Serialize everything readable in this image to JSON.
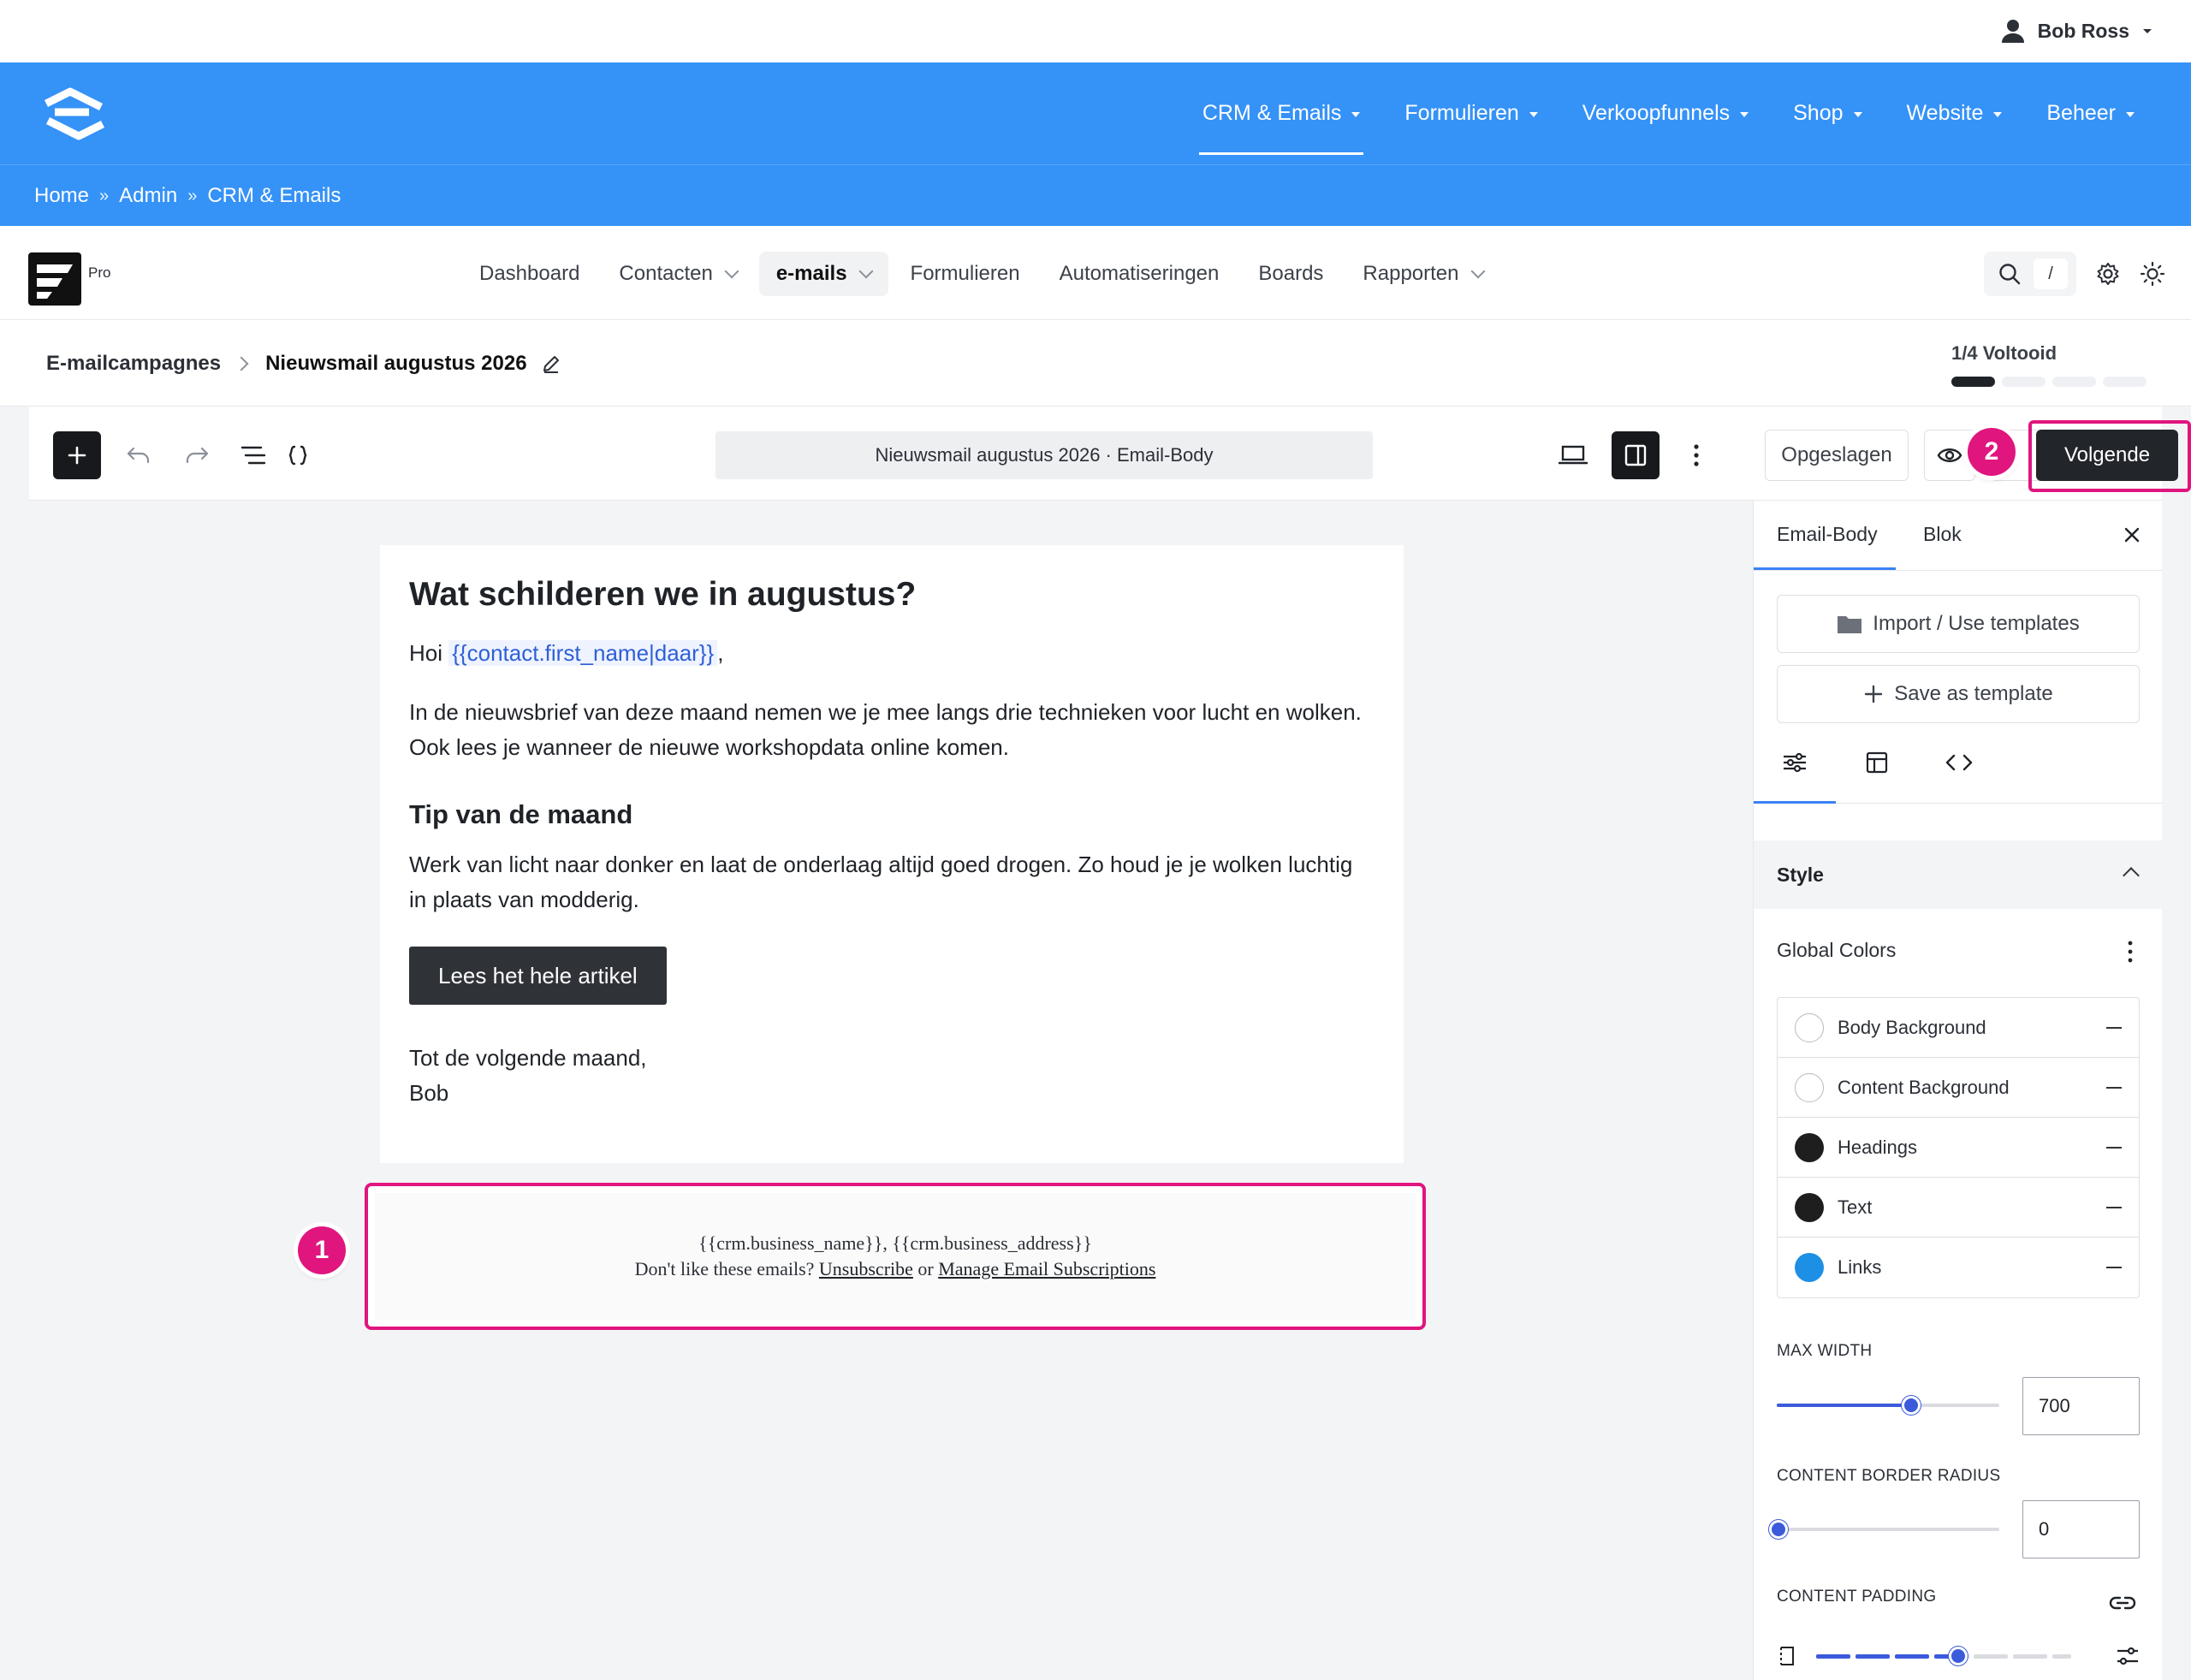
{
  "user": {
    "name": "Bob Ross"
  },
  "site_nav": {
    "items": [
      {
        "label": "CRM & Emails",
        "active": true
      },
      {
        "label": "Formulieren"
      },
      {
        "label": "Verkoopfunnels"
      },
      {
        "label": "Shop"
      },
      {
        "label": "Website"
      },
      {
        "label": "Beheer"
      }
    ]
  },
  "breadcrumb": {
    "items": [
      "Home",
      "Admin",
      "CRM & Emails"
    ],
    "separator": "»"
  },
  "app": {
    "badge": "Pro",
    "nav": [
      "Dashboard",
      "Contacten",
      "e-mails",
      "Formulieren",
      "Automatiseringen",
      "Boards",
      "Rapporten"
    ],
    "search_shortcut": "/"
  },
  "campaign": {
    "parent": "E-mailcampagnes",
    "name": "Nieuwsmail augustus 2026",
    "progress_label": "1/4 Voltooid",
    "progress": {
      "done": 1,
      "total": 4
    }
  },
  "editor": {
    "doc_title": "Nieuwsmail augustus 2026 · Email-Body",
    "saved_label": "Opgeslagen",
    "next_label": "Volgende",
    "markers": [
      "1",
      "2"
    ]
  },
  "email": {
    "heading": "Wat schilderen we in augustus?",
    "greeting_prefix": "Hoi",
    "greeting_tag": "{{contact.first_name|daar}}",
    "greeting_suffix": ",",
    "intro": "In de nieuwsbrief van deze maand nemen we je mee langs drie technieken voor lucht en wolken. Ook lees je wanneer de nieuwe workshopdata online komen.",
    "subheading": "Tip van de maand",
    "tip": "Werk van licht naar donker en laat de onderlaag altijd goed drogen. Zo houd je je wolken luchtig in plaats van modderig.",
    "button_label": "Lees het hele artikel",
    "closing": "Tot de volgende maand,",
    "signature": "Bob",
    "footer": {
      "business_line": "{{crm.business_name}}, {{crm.business_address}}",
      "unsub_prefix": "Don't like these emails?",
      "unsub_link": "Unsubscribe",
      "or": "or",
      "manage_link": "Manage Email Subscriptions"
    }
  },
  "panel": {
    "tabs": [
      "Email-Body",
      "Blok"
    ],
    "import_label": "Import / Use templates",
    "save_template_label": "Save as template",
    "section_title": "Style",
    "global_colors_label": "Global Colors",
    "colors": [
      {
        "name": "Body Background",
        "color": "#ffffff"
      },
      {
        "name": "Content Background",
        "color": "#ffffff"
      },
      {
        "name": "Headings",
        "color": "#1e1e1e"
      },
      {
        "name": "Text",
        "color": "#1e1e1e"
      },
      {
        "name": "Links",
        "color": "#1d8fe4"
      }
    ],
    "max_width_label": "MAX WIDTH",
    "max_width_value": "700",
    "border_radius_label": "CONTENT BORDER RADIUS",
    "border_radius_value": "0",
    "padding_label": "CONTENT PADDING"
  },
  "colors": {
    "brand_blue": "#3592f7",
    "highlight": "#e0157e",
    "accent": "#3b5bdb"
  }
}
